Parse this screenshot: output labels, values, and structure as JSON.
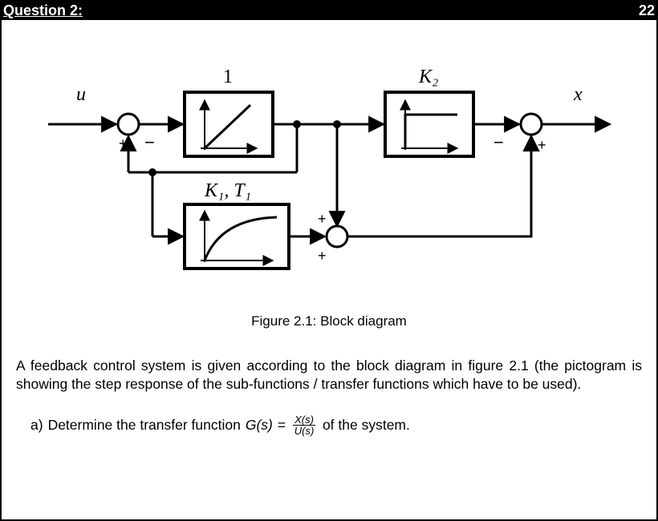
{
  "header": {
    "title": "Question 2:",
    "points": "22"
  },
  "diagram": {
    "input_label": "u",
    "output_label": "x",
    "block_top_label": "1",
    "block_right_label": "K₂",
    "block_bottom_label": "K₁, T₁",
    "sum1": {
      "left": "+",
      "right": "−"
    },
    "sum2": {
      "top": "+",
      "bottom": "+"
    },
    "sum3": {
      "left": "−",
      "right": "+"
    }
  },
  "caption": "Figure 2.1: Block diagram",
  "paragraph": "A feedback control system is given according to the block diagram in figure 2.1 (the pictogram is showing the step response of the sub-functions / transfer functions which have to be used).",
  "part_a": {
    "letter": "a)",
    "lead": "Determine the transfer function",
    "G": "G(s)",
    "eq": "=",
    "num": "X(s)",
    "den": "U(s)",
    "tail": "of the system."
  },
  "chart_data": {
    "type": "block-diagram",
    "notes": "Pictograms inside blocks depict step responses",
    "blocks": [
      {
        "id": "B1",
        "label": "1",
        "pictogram": "ramp (integrator step response)",
        "transfer_function_hint": "1/s"
      },
      {
        "id": "B2",
        "label": "K2",
        "pictogram": "step (constant gain)",
        "transfer_function_hint": "K2"
      },
      {
        "id": "B3",
        "label": "K1, T1",
        "pictogram": "exponential rise (first-order lag / PT1)",
        "transfer_function_hint": "K1 / (T1 s + 1)"
      }
    ],
    "summing_junctions": [
      {
        "id": "S1",
        "inputs": [
          {
            "from": "u",
            "sign": "+"
          },
          {
            "from": "B1_out",
            "sign": "-"
          }
        ],
        "output_to": "B1"
      },
      {
        "id": "S2",
        "inputs": [
          {
            "from": "B1_out",
            "sign": "+"
          },
          {
            "from": "B3_out",
            "sign": "+"
          }
        ],
        "output_to": "B2"
      },
      {
        "id": "S3",
        "inputs": [
          {
            "from": "B2_out",
            "sign": "-"
          },
          {
            "from": "x",
            "sign": "+"
          }
        ],
        "output_to": "x"
      }
    ],
    "signals": {
      "input": "u",
      "output": "x"
    },
    "goal": "G(s) = X(s) / U(s)"
  }
}
